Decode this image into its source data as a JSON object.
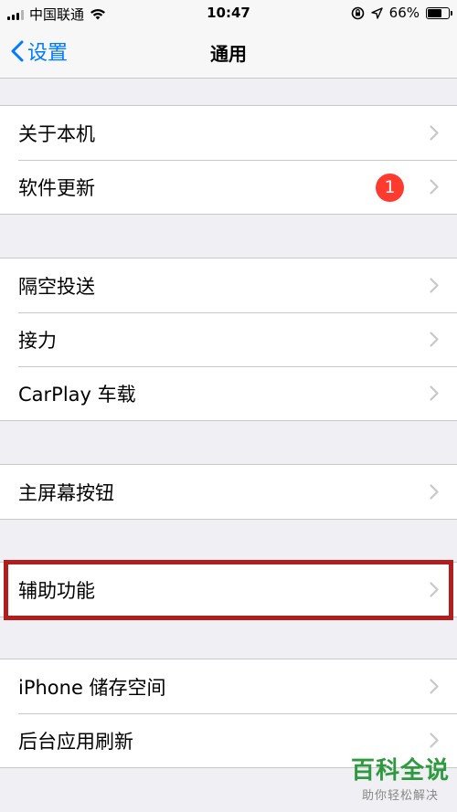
{
  "status_bar": {
    "carrier": "中国联通",
    "time": "10:47",
    "battery": "66%",
    "battery_level": 0.66,
    "icons": [
      "signal-icon",
      "wifi-icon",
      "orientation-lock-icon",
      "location-icon",
      "battery-icon"
    ]
  },
  "nav": {
    "back_label": "设置",
    "title": "通用"
  },
  "groups": [
    {
      "items": [
        {
          "label": "关于本机"
        },
        {
          "label": "软件更新",
          "badge": "1"
        }
      ]
    },
    {
      "items": [
        {
          "label": "隔空投送"
        },
        {
          "label": "接力"
        },
        {
          "label": "CarPlay 车载"
        }
      ]
    },
    {
      "items": [
        {
          "label": "主屏幕按钮"
        }
      ]
    },
    {
      "items": [
        {
          "label": "辅助功能",
          "highlighted": true
        }
      ]
    },
    {
      "items": [
        {
          "label": "iPhone 储存空间"
        },
        {
          "label": "后台应用刷新"
        }
      ]
    }
  ],
  "watermark": {
    "title": "百科全说",
    "subtitle": "助你轻松解决"
  },
  "colors": {
    "accent": "#007aff",
    "badge": "#ff3b30",
    "highlight_border": "#b01e1e",
    "background": "#efeff4",
    "watermark": "#2e9a3e"
  }
}
